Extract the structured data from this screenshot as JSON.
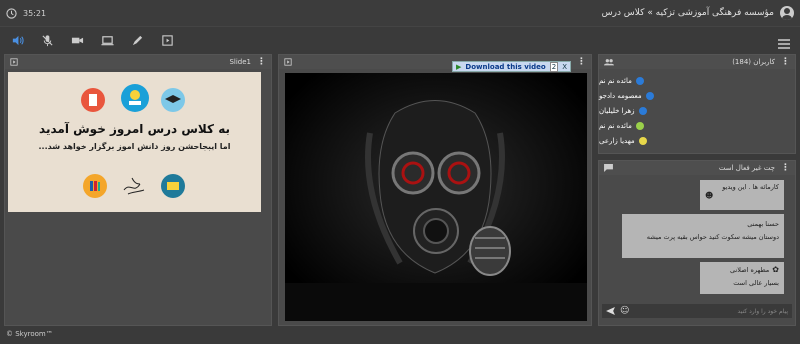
{
  "topbar": {
    "timer": "35:21",
    "breadcrumb": "مؤسسه فرهنگی آموزشی تزکیه » کلاس درس"
  },
  "toolbar": {
    "icons": [
      "speaker-icon",
      "mic-off-icon",
      "camera-icon",
      "screen-share-icon",
      "pen-icon",
      "play-box-icon",
      "menu-icon"
    ]
  },
  "slide_panel": {
    "title": "Slide1",
    "heading": "به کلاس درس امروز خوش آمدید",
    "subheading": "اما ایبجاحشن روز دانش اموز برگزار خواهد شد..."
  },
  "video_panel": {
    "download_label": "Download this video",
    "download_badge": "2",
    "download_close": "X"
  },
  "users_panel": {
    "title": "کاربران (184)",
    "users": [
      {
        "name": "مائده نم نم",
        "color": "#2b7bd8"
      },
      {
        "name": "معصومه دادجو",
        "color": "#2b7bd8"
      },
      {
        "name": "زهرا خلیلیان",
        "color": "#2b7bd8"
      },
      {
        "name": "مائده نم نم",
        "color": "#9ad04a"
      },
      {
        "name": "مهدیا زارعی",
        "color": "#e8d84a"
      }
    ]
  },
  "chat_panel": {
    "title": "چت غیر فعال است",
    "messages": [
      {
        "text": "کارمائه ها .  این ویدیو"
      },
      {
        "author": "حسنا بهمنی",
        "text": "دوستان میشه سکوت کنید حواس بقیه پرت میشه"
      },
      {
        "author": "مطهره اصلانی",
        "text": "بسیار عالی است"
      }
    ],
    "input_placeholder": "پیام خود را وارد کنید"
  },
  "footer": {
    "text": "© Skyroom™"
  }
}
